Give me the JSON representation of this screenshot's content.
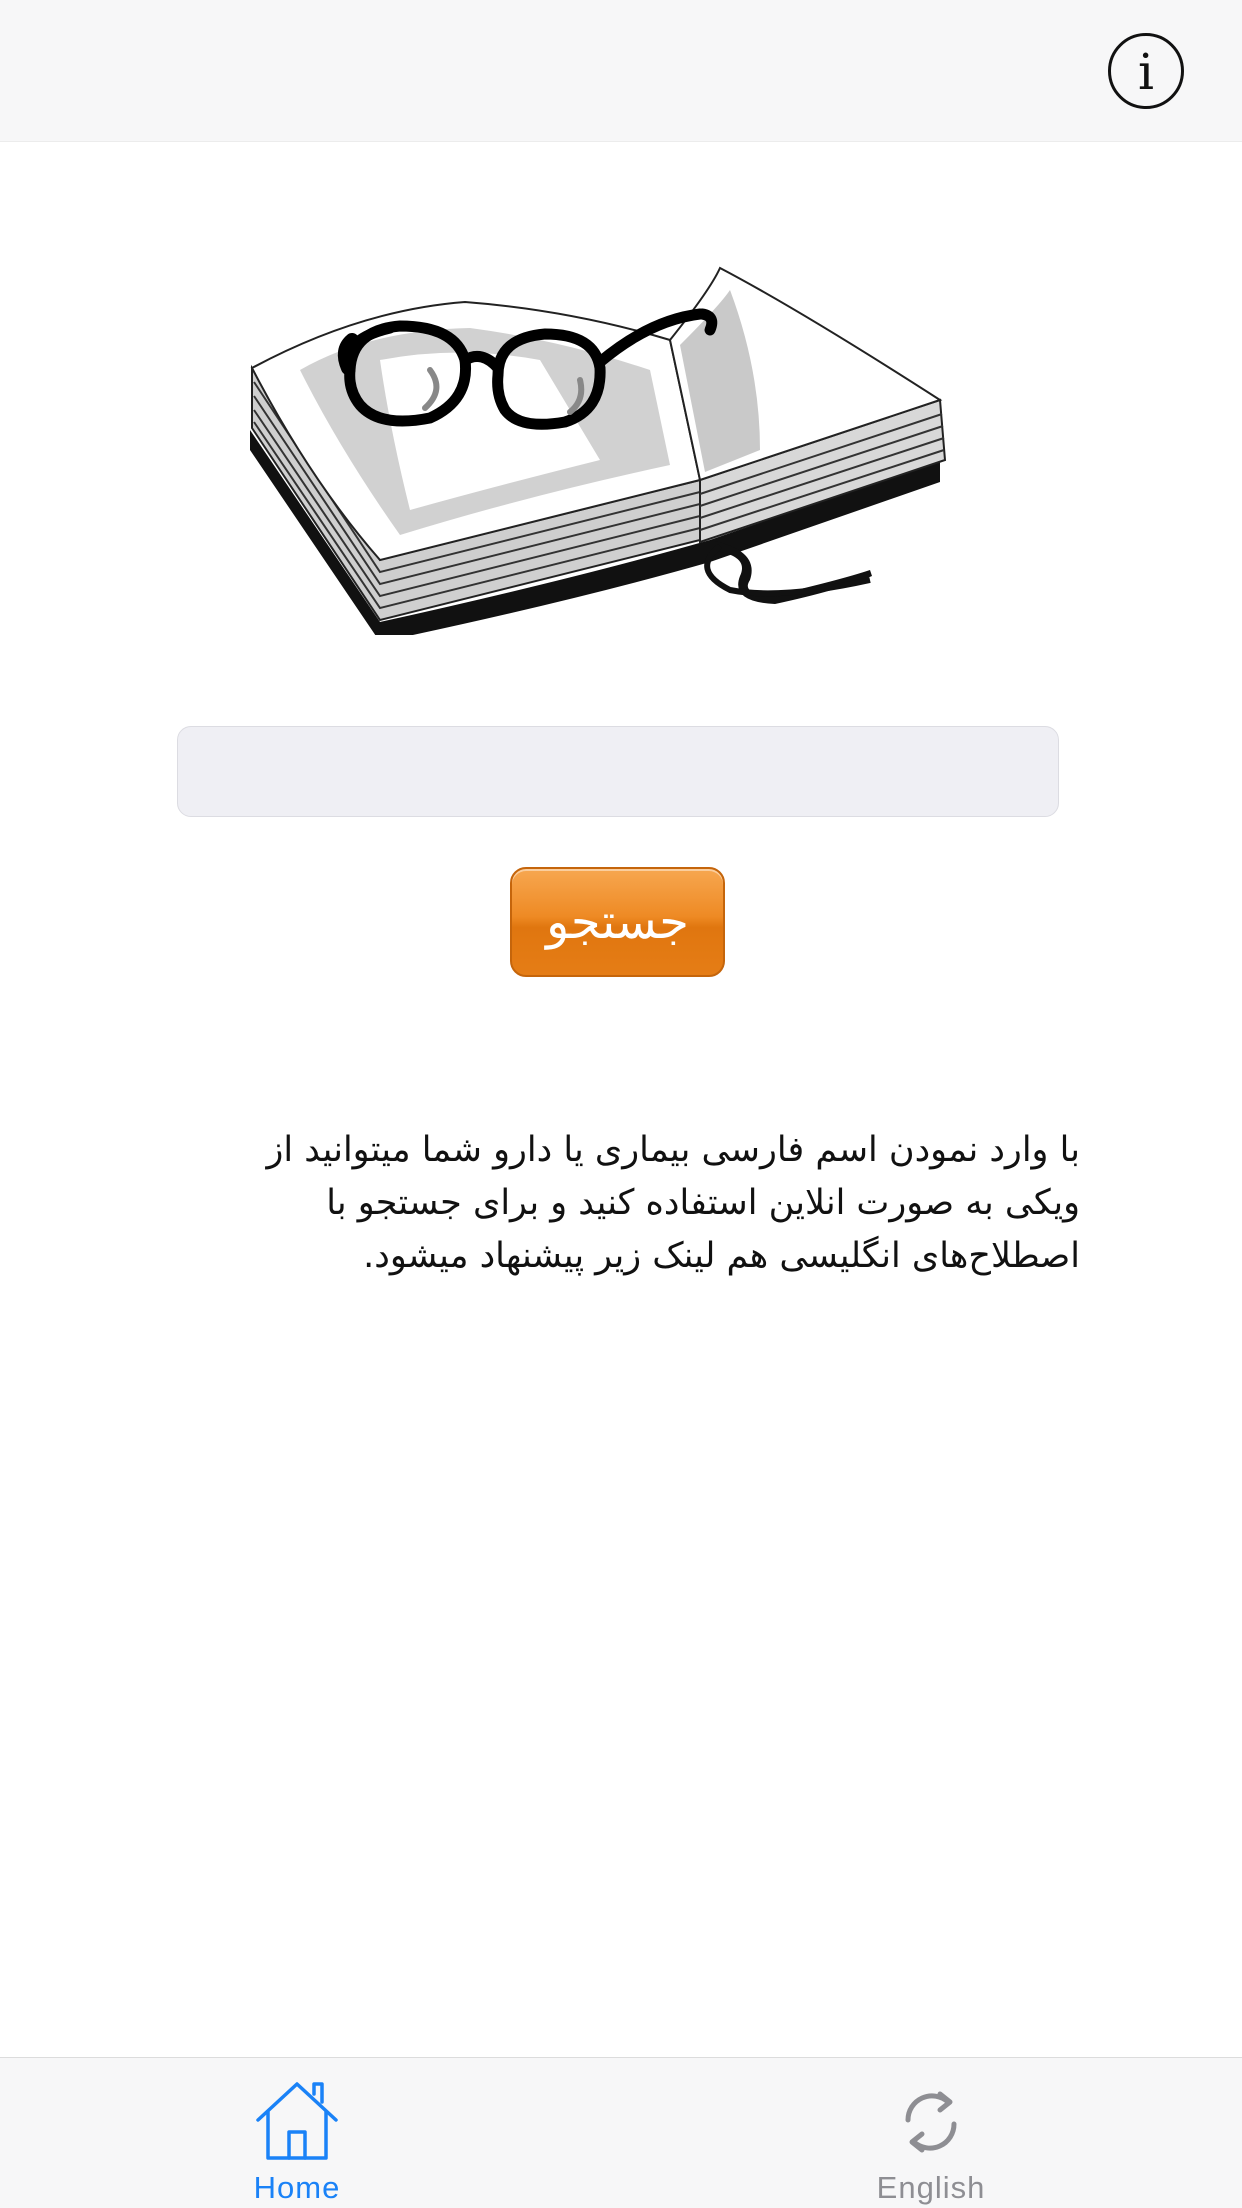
{
  "navbar": {
    "info_icon": "info-circle-icon",
    "info_glyph": "i"
  },
  "main": {
    "illustration": "open-book-with-glasses",
    "search": {
      "value": "",
      "placeholder": ""
    },
    "search_button_label": "جستجو",
    "description": "با وارد نمودن اسم فارسی  بیماری یا دارو شما میتوانید از ویکی به صورت انلاین استفاده کنید و برای جستجو با اصطلاح‌های انگلیسی هم لینک زیر پیشنهاد میشود."
  },
  "tabbar": {
    "tabs": [
      {
        "label": "Home",
        "icon": "home-icon",
        "selected": true
      },
      {
        "label": "English",
        "icon": "refresh-icon",
        "selected": false
      }
    ]
  },
  "colors": {
    "accent": "#1a82f7",
    "inactive": "#8e8e93",
    "button_orange": "#ee8a24"
  }
}
